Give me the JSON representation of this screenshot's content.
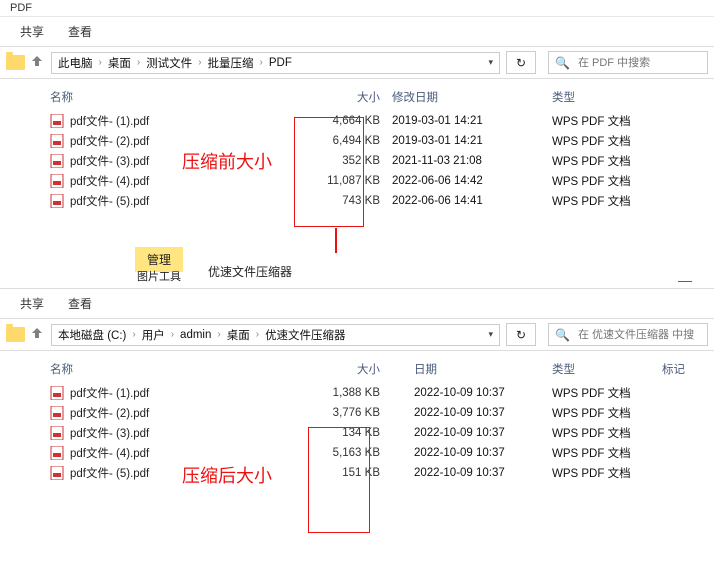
{
  "top_window": {
    "title_hint": "PDF",
    "menu": {
      "share": "共享",
      "view": "查看"
    },
    "breadcrumbs": [
      "此电脑",
      "桌面",
      "测试文件",
      "批量压缩",
      "PDF"
    ],
    "search_placeholder": "在 PDF 中搜索",
    "columns": {
      "name": "名称",
      "size": "大小",
      "date": "修改日期",
      "type": "类型"
    },
    "files": [
      {
        "name": "pdf文件- (1).pdf",
        "size": "4,664 KB",
        "date": "2019-03-01 14:21",
        "type": "WPS PDF 文档"
      },
      {
        "name": "pdf文件- (2).pdf",
        "size": "6,494 KB",
        "date": "2019-03-01 14:21",
        "type": "WPS PDF 文档"
      },
      {
        "name": "pdf文件- (3).pdf",
        "size": "352 KB",
        "date": "2021-11-03 21:08",
        "type": "WPS PDF 文档"
      },
      {
        "name": "pdf文件- (4).pdf",
        "size": "11,087 KB",
        "date": "2022-06-06 14:42",
        "type": "WPS PDF 文档"
      },
      {
        "name": "pdf文件- (5).pdf",
        "size": "743 KB",
        "date": "2022-06-06 14:41",
        "type": "WPS PDF 文档"
      }
    ],
    "annotation": "压缩前大小"
  },
  "bottom_window": {
    "tabs": {
      "manage": "管理",
      "pic_tools": "图片工具",
      "title": "优速文件压缩器"
    },
    "menu": {
      "share": "共享",
      "view": "查看"
    },
    "breadcrumbs": [
      "本地磁盘 (C:)",
      "用户",
      "admin",
      "桌面",
      "优速文件压缩器"
    ],
    "search_placeholder": "在 优速文件压缩器 中搜",
    "columns": {
      "name": "名称",
      "size": "大小",
      "date": "日期",
      "type": "类型",
      "tag": "标记"
    },
    "files": [
      {
        "name": "pdf文件- (1).pdf",
        "size": "1,388 KB",
        "date": "2022-10-09 10:37",
        "type": "WPS PDF 文档"
      },
      {
        "name": "pdf文件- (2).pdf",
        "size": "3,776 KB",
        "date": "2022-10-09 10:37",
        "type": "WPS PDF 文档"
      },
      {
        "name": "pdf文件- (3).pdf",
        "size": "134 KB",
        "date": "2022-10-09 10:37",
        "type": "WPS PDF 文档"
      },
      {
        "name": "pdf文件- (4).pdf",
        "size": "5,163 KB",
        "date": "2022-10-09 10:37",
        "type": "WPS PDF 文档"
      },
      {
        "name": "pdf文件- (5).pdf",
        "size": "151 KB",
        "date": "2022-10-09 10:37",
        "type": "WPS PDF 文档"
      }
    ],
    "annotation": "压缩后大小"
  },
  "icons": {
    "search": "🔍",
    "refresh": "↻"
  }
}
